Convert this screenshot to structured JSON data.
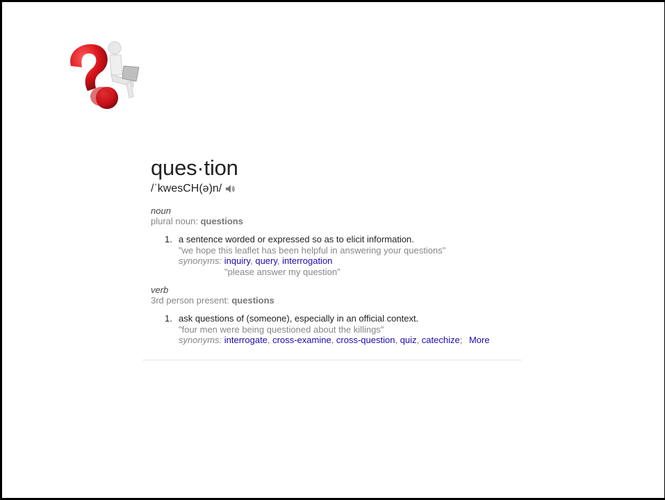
{
  "entry": {
    "headword": "ques·tion",
    "pronunciation": "/ˈkwesCH(ə)n/",
    "speaker_icon": "speaker-icon"
  },
  "noun": {
    "pos": "noun",
    "inflection_label": "plural noun: ",
    "inflection_value": "questions",
    "definitions": [
      {
        "number": "1.",
        "text": "a sentence worded or expressed so as to elicit information.",
        "example": "\"we hope this leaflet has been helpful in answering your questions\"",
        "synonyms_label": "synonyms:",
        "synonyms": [
          "inquiry",
          "query",
          "interrogation"
        ],
        "synonym_example": "\"please answer my question\""
      }
    ]
  },
  "verb": {
    "pos": "verb",
    "inflection_label": "3rd person present: ",
    "inflection_value": "questions",
    "definitions": [
      {
        "number": "1.",
        "text": "ask questions of (someone), especially in an official context.",
        "example": "\"four men were being questioned about the killings\"",
        "synonyms_label": "synonyms:",
        "synonyms": [
          "interrogate",
          "cross-examine",
          "cross-question",
          "quiz",
          "catechize"
        ],
        "more_label": "More"
      }
    ]
  },
  "colors": {
    "link": "#1a0dab",
    "muted": "#878787",
    "text": "#222222",
    "question_mark_red": "#d9141b"
  }
}
